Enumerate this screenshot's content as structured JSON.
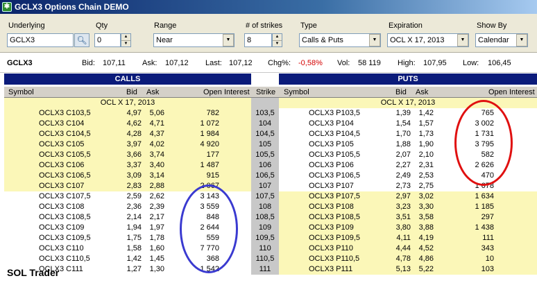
{
  "window": {
    "title": "GCLX3 Options Chain DEMO"
  },
  "toolbar": {
    "underlying": {
      "label": "Underlying",
      "value": "GCLX3"
    },
    "qty": {
      "label": "Qty",
      "value": "0"
    },
    "range": {
      "label": "Range",
      "value": "Near"
    },
    "strikes": {
      "label": "# of strikes",
      "value": "8"
    },
    "type": {
      "label": "Type",
      "value": "Calls & Puts"
    },
    "expiration": {
      "label": "Expiration",
      "value": "OCL X 17, 2013"
    },
    "showby": {
      "label": "Show By",
      "value": "Calendar"
    }
  },
  "quote": {
    "symbol": "GCLX3",
    "bid_label": "Bid:",
    "bid": "107,11",
    "ask_label": "Ask:",
    "ask": "107,12",
    "last_label": "Last:",
    "last": "107,12",
    "chg_label": "Chg%:",
    "chg": "-0,58%",
    "vol_label": "Vol:",
    "vol": "58 119",
    "high_label": "High:",
    "high": "107,95",
    "low_label": "Low:",
    "low": "106,45"
  },
  "headers": {
    "calls": "CALLS",
    "puts": "PUTS",
    "symbol": "Symbol",
    "bid": "Bid",
    "ask": "Ask",
    "oi": "Open Interest",
    "strike": "Strike"
  },
  "expiry_group": "OCL X 17, 2013",
  "colors": {
    "itm": "#fbf7b8",
    "header": "#0b1b7a",
    "red_circle": "#e01010",
    "blue_circle": "#3a3ad0"
  },
  "calls": [
    {
      "symbol": "OCLX3 C103,5",
      "bid": "4,97",
      "ask": "5,06",
      "oi": "782"
    },
    {
      "symbol": "OCLX3 C104",
      "bid": "4,62",
      "ask": "4,71",
      "oi": "1 072"
    },
    {
      "symbol": "OCLX3 C104,5",
      "bid": "4,28",
      "ask": "4,37",
      "oi": "1 984"
    },
    {
      "symbol": "OCLX3 C105",
      "bid": "3,97",
      "ask": "4,02",
      "oi": "4 920"
    },
    {
      "symbol": "OCLX3 C105,5",
      "bid": "3,66",
      "ask": "3,74",
      "oi": "177"
    },
    {
      "symbol": "OCLX3 C106",
      "bid": "3,37",
      "ask": "3,40",
      "oi": "1 487"
    },
    {
      "symbol": "OCLX3 C106,5",
      "bid": "3,09",
      "ask": "3,14",
      "oi": "915"
    },
    {
      "symbol": "OCLX3 C107",
      "bid": "2,83",
      "ask": "2,88",
      "oi": "2 067"
    },
    {
      "symbol": "OCLX3 C107,5",
      "bid": "2,59",
      "ask": "2,62",
      "oi": "3 143"
    },
    {
      "symbol": "OCLX3 C108",
      "bid": "2,36",
      "ask": "2,39",
      "oi": "3 559"
    },
    {
      "symbol": "OCLX3 C108,5",
      "bid": "2,14",
      "ask": "2,17",
      "oi": "848"
    },
    {
      "symbol": "OCLX3 C109",
      "bid": "1,94",
      "ask": "1,97",
      "oi": "2 644"
    },
    {
      "symbol": "OCLX3 C109,5",
      "bid": "1,75",
      "ask": "1,78",
      "oi": "559"
    },
    {
      "symbol": "OCLX3 C110",
      "bid": "1,58",
      "ask": "1,60",
      "oi": "7 770"
    },
    {
      "symbol": "OCLX3 C110,5",
      "bid": "1,42",
      "ask": "1,45",
      "oi": "368"
    },
    {
      "symbol": "OCLX3 C111",
      "bid": "1,27",
      "ask": "1,30",
      "oi": "1 542"
    }
  ],
  "strikes": [
    "103,5",
    "104",
    "104,5",
    "105",
    "105,5",
    "106",
    "106,5",
    "107",
    "107,5",
    "108",
    "108,5",
    "109",
    "109,5",
    "110",
    "110,5",
    "111"
  ],
  "puts": [
    {
      "symbol": "OCLX3 P103,5",
      "bid": "1,39",
      "ask": "1,42",
      "oi": "765"
    },
    {
      "symbol": "OCLX3 P104",
      "bid": "1,54",
      "ask": "1,57",
      "oi": "3 002"
    },
    {
      "symbol": "OCLX3 P104,5",
      "bid": "1,70",
      "ask": "1,73",
      "oi": "1 731"
    },
    {
      "symbol": "OCLX3 P105",
      "bid": "1,88",
      "ask": "1,90",
      "oi": "3 795"
    },
    {
      "symbol": "OCLX3 P105,5",
      "bid": "2,07",
      "ask": "2,10",
      "oi": "582"
    },
    {
      "symbol": "OCLX3 P106",
      "bid": "2,27",
      "ask": "2,31",
      "oi": "2 626"
    },
    {
      "symbol": "OCLX3 P106,5",
      "bid": "2,49",
      "ask": "2,53",
      "oi": "470"
    },
    {
      "symbol": "OCLX3 P107",
      "bid": "2,73",
      "ask": "2,75",
      "oi": "1 678"
    },
    {
      "symbol": "OCLX3 P107,5",
      "bid": "2,97",
      "ask": "3,02",
      "oi": "1 634"
    },
    {
      "symbol": "OCLX3 P108",
      "bid": "3,23",
      "ask": "3,30",
      "oi": "1 185"
    },
    {
      "symbol": "OCLX3 P108,5",
      "bid": "3,51",
      "ask": "3,58",
      "oi": "297"
    },
    {
      "symbol": "OCLX3 P109",
      "bid": "3,80",
      "ask": "3,88",
      "oi": "1 438"
    },
    {
      "symbol": "OCLX3 P109,5",
      "bid": "4,11",
      "ask": "4,19",
      "oi": "111"
    },
    {
      "symbol": "OCLX3 P110",
      "bid": "4,44",
      "ask": "4,52",
      "oi": "343"
    },
    {
      "symbol": "OCLX3 P110,5",
      "bid": "4,78",
      "ask": "4,86",
      "oi": "10"
    },
    {
      "symbol": "OCLX3 P111",
      "bid": "5,13",
      "ask": "5,22",
      "oi": "103"
    }
  ],
  "itm_calls_count": 8,
  "itm_puts_from": 8,
  "footer": "SOL Trader"
}
